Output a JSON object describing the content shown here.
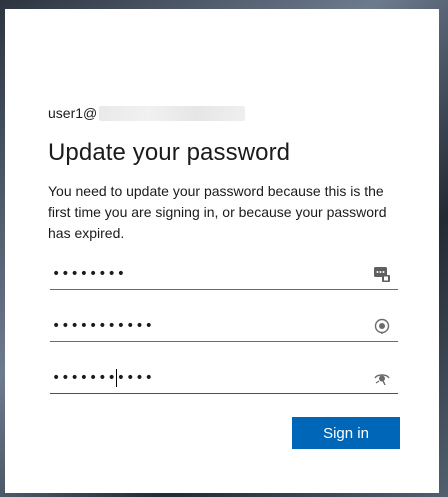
{
  "identity": {
    "username": "user1@"
  },
  "page": {
    "title": "Update your password",
    "description": "You need to update your password because this is the first time you are signing in, or because your password has expired."
  },
  "fields": [
    {
      "name": "current-password",
      "value": "••••••••",
      "icon": "password-manager-key-icon",
      "active": false
    },
    {
      "name": "new-password",
      "value": "•••••••••••",
      "icon": "password-reveal-icon",
      "active": false
    },
    {
      "name": "confirm-password",
      "value": "•••••••••••",
      "icon": "password-reveal-icon",
      "active": true
    }
  ],
  "actions": {
    "sign_in_label": "Sign in"
  },
  "colors": {
    "accent": "#0067b8",
    "text": "#1b1b1b",
    "underline": "#6b6b6b"
  }
}
